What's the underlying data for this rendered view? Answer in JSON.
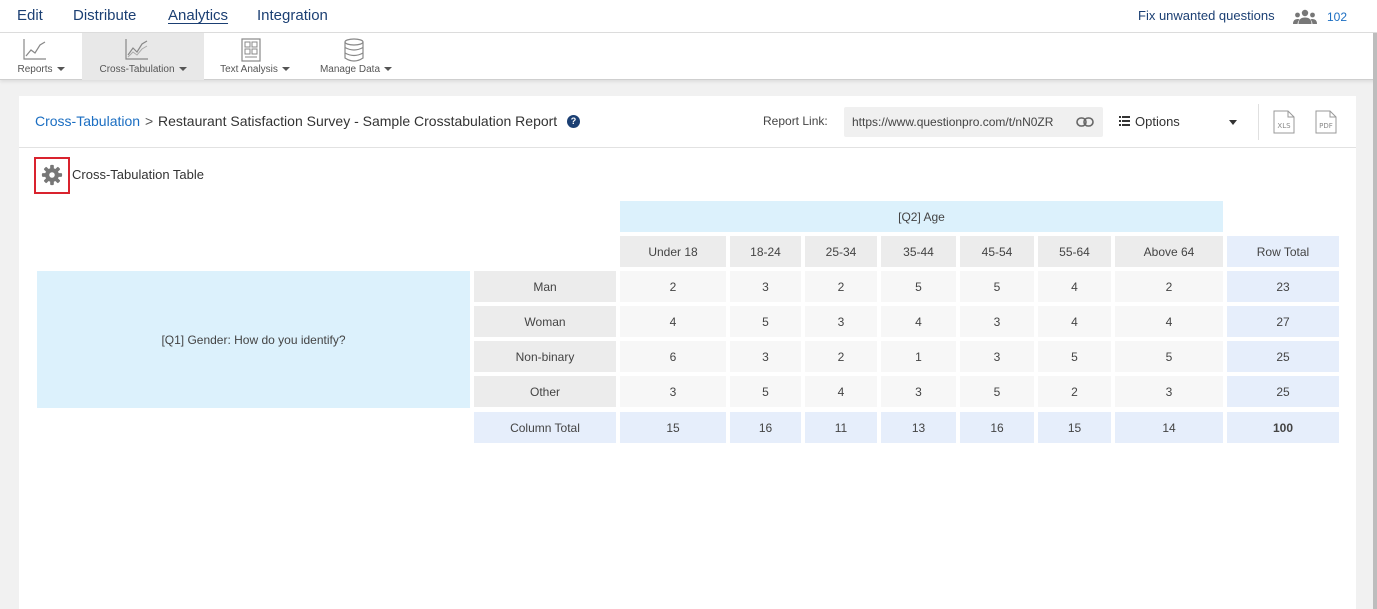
{
  "topnav": {
    "items": [
      "Edit",
      "Distribute",
      "Analytics",
      "Integration"
    ],
    "fix_link": "Fix unwanted questions",
    "user_count": "102"
  },
  "toolbar": {
    "tools": [
      "Reports",
      "Cross-Tabulation",
      "Text Analysis",
      "Manage Data"
    ]
  },
  "header": {
    "breadcrumb_link": "Cross-Tabulation",
    "separator": ">",
    "title": "Restaurant Satisfaction Survey - Sample Crosstabulation Report",
    "report_link_label": "Report Link:",
    "report_link_value": "https://www.questionpro.com/t/nN0ZR",
    "options_label": "Options",
    "xls_label": "XLS",
    "pdf_label": "PDF"
  },
  "section": {
    "title": "Cross-Tabulation Table"
  },
  "crosstab": {
    "column_question": "[Q2] Age",
    "row_question": "[Q1] Gender: How do you identify?",
    "columns": [
      "Under 18",
      "18-24",
      "25-34",
      "35-44",
      "45-54",
      "55-64",
      "Above 64"
    ],
    "row_total_label": "Row Total",
    "rows": [
      {
        "label": "Man",
        "values": [
          "2",
          "3",
          "2",
          "5",
          "5",
          "4",
          "2"
        ],
        "total": "23"
      },
      {
        "label": "Woman",
        "values": [
          "4",
          "5",
          "3",
          "4",
          "3",
          "4",
          "4"
        ],
        "total": "27"
      },
      {
        "label": "Non-binary",
        "values": [
          "6",
          "3",
          "2",
          "1",
          "3",
          "5",
          "5"
        ],
        "total": "25"
      },
      {
        "label": "Other",
        "values": [
          "3",
          "5",
          "4",
          "3",
          "5",
          "2",
          "3"
        ],
        "total": "25"
      }
    ],
    "column_total": {
      "label": "Column Total",
      "values": [
        "15",
        "16",
        "11",
        "13",
        "16",
        "15",
        "14"
      ],
      "total": "100"
    }
  }
}
